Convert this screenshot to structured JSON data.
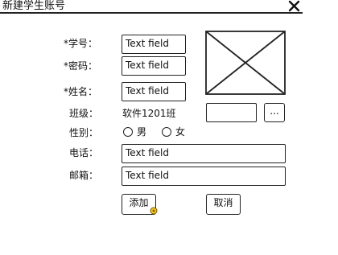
{
  "window": {
    "title": "新建学生账号",
    "close_icon": "close-icon"
  },
  "form": {
    "student_id": {
      "label": "*学号：",
      "value": "Text field"
    },
    "password": {
      "label": "*密码：",
      "value": "Text field"
    },
    "name": {
      "label": "*姓名：",
      "value": "Text field"
    },
    "class": {
      "label": "班级：",
      "value": "软件1201班",
      "browse_label": "..."
    },
    "gender": {
      "label": "性别：",
      "options": [
        "男",
        "女"
      ]
    },
    "phone": {
      "label": "电话：",
      "value": "Text field"
    },
    "email": {
      "label": "邮箱：",
      "value": "Text field"
    }
  },
  "photo": {
    "icon": "image-placeholder-icon"
  },
  "actions": {
    "add_label": "添加",
    "cancel_label": "取消"
  }
}
